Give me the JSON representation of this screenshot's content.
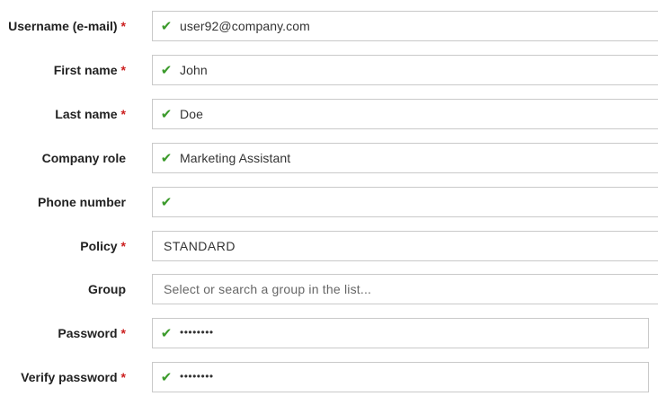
{
  "form": {
    "username": {
      "label": "Username (e-mail)",
      "required": "*",
      "value": "user92@company.com",
      "valid_icon": "✔"
    },
    "first_name": {
      "label": "First name",
      "required": "*",
      "value": "John",
      "valid_icon": "✔"
    },
    "last_name": {
      "label": "Last name",
      "required": "*",
      "value": "Doe",
      "valid_icon": "✔"
    },
    "company_role": {
      "label": "Company role",
      "value": "Marketing Assistant",
      "valid_icon": "✔"
    },
    "phone_number": {
      "label": "Phone number",
      "value": "",
      "valid_icon": "✔"
    },
    "policy": {
      "label": "Policy",
      "required": "*",
      "value": "STANDARD"
    },
    "group": {
      "label": "Group",
      "placeholder": "Select or search a group in the list..."
    },
    "password": {
      "label": "Password",
      "required": "*",
      "value": "••••••••",
      "valid_icon": "✔"
    },
    "verify_password": {
      "label": "Verify password",
      "required": "*",
      "value": "••••••••",
      "valid_icon": "✔"
    }
  },
  "colors": {
    "required": "#cc1f1f",
    "valid_check": "#3a9a2a",
    "border": "#c9c9c9"
  },
  "icons": {
    "valid": "checkmark-icon"
  }
}
